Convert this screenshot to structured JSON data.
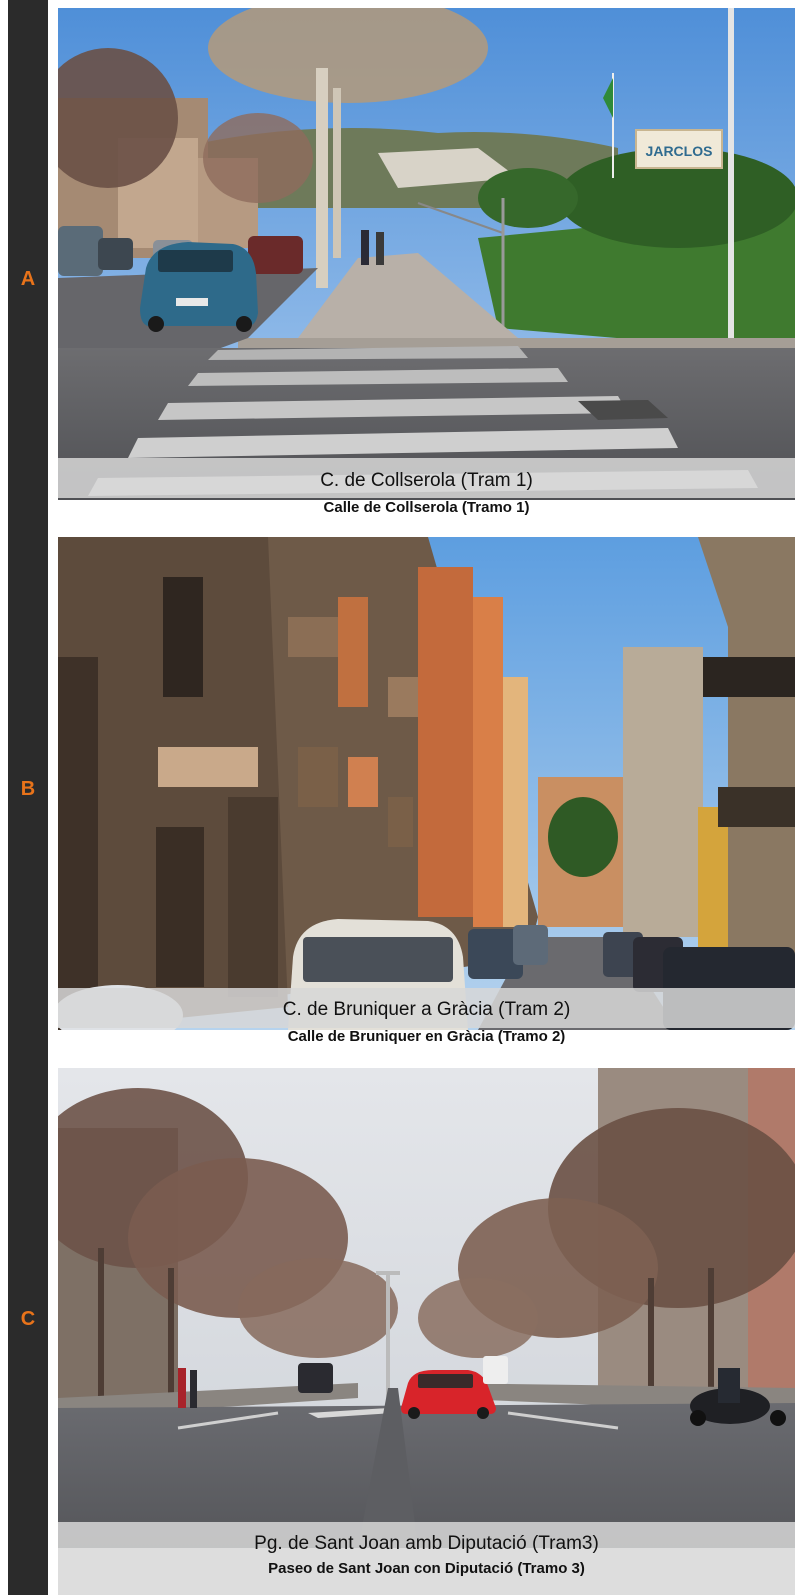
{
  "panels": [
    {
      "letter": "A",
      "sign": "JARCLOS",
      "caption_main": "C. de Collserola (Tram 1)",
      "caption_sub": "Calle de Collserola (Tramo 1)"
    },
    {
      "letter": "B",
      "caption_main": "C. de Bruniquer a Gràcia (Tram 2)",
      "caption_sub": "Calle de Bruniquer en Gràcia (Tramo 2)"
    },
    {
      "letter": "C",
      "caption_main": "Pg. de Sant Joan amb Diputació  (Tram3)",
      "caption_sub": "Paseo de Sant Joan con Diputació (Tramo 3)"
    }
  ],
  "colors": {
    "left_bar": "#2b2b2b",
    "letter": "#e8731a",
    "caption_band": "#d7d7d7"
  }
}
